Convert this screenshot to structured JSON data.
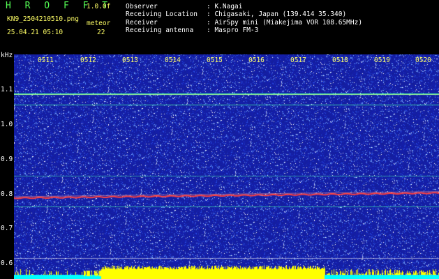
{
  "header": {
    "logo": "H R O F F T",
    "version": "1.0.0f",
    "filename": "KN9_2504210510.png",
    "meteor_label": "meteor",
    "meteor_count": "22",
    "datetime": "25.04.21 05:10",
    "info_labels": [
      "Observer",
      "Receiving Location",
      "Receiver",
      "Receiving antenna"
    ],
    "info_values": [
      ": K.Nagai",
      ": Chigasaki, Japan (139.414 35.340)",
      ": AirSpy mini (Miakejima VOR 108.65MHz)",
      ": Maspro FM-3"
    ]
  },
  "axis": {
    "unit": "kHz",
    "y_ticks": [
      "1.1",
      "1.0",
      "0.9",
      "0.8",
      "0.7",
      "0.6"
    ],
    "x_ticks": [
      "0511",
      "0512",
      "0513",
      "0514",
      "0515",
      "0516",
      "0517",
      "0518",
      "0519",
      "0520"
    ]
  },
  "colors": {
    "background_noise": "#1a2a9a",
    "signal_line": "#ff4040",
    "carrier_line": "#44ffaa",
    "yellow_band": "#ffff00",
    "cyan_band": "#00ffff",
    "text_yellow": "#ffff66",
    "text_white": "#ffffff",
    "logo_green": "#55ff55"
  }
}
